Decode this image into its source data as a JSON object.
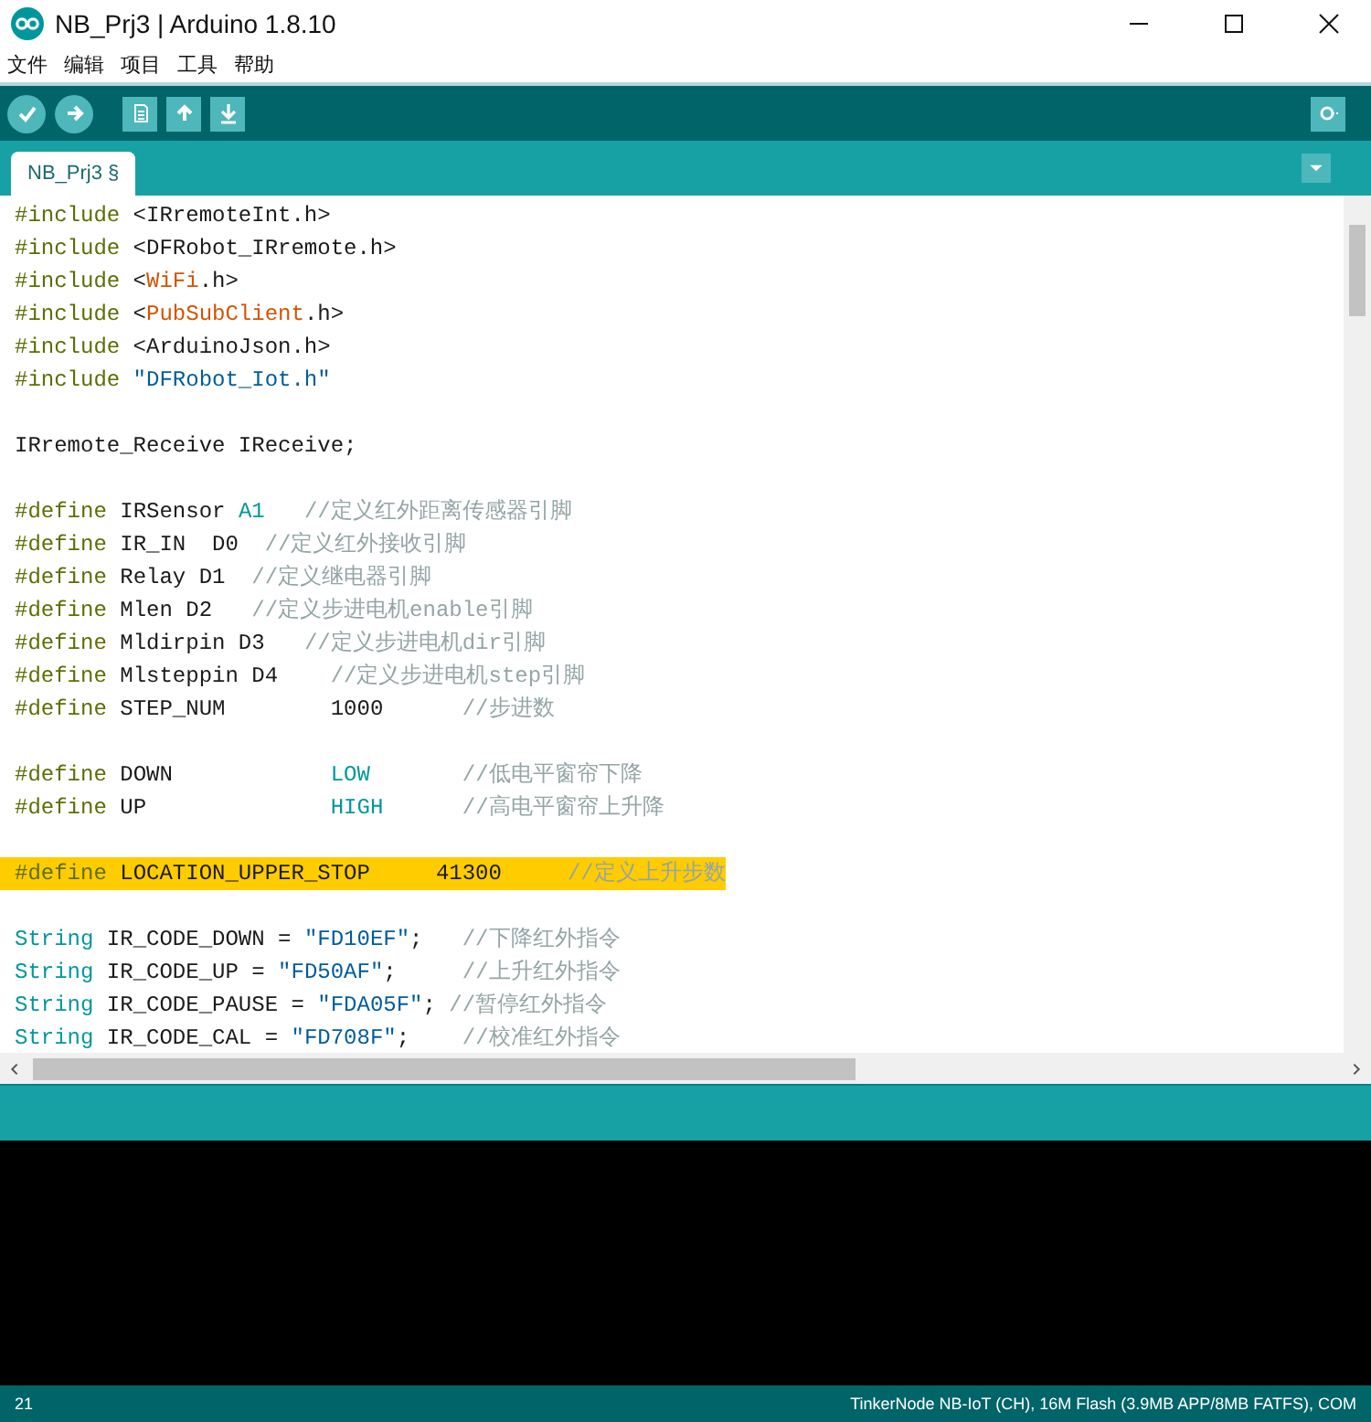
{
  "window": {
    "title": "NB_Prj3 | Arduino 1.8.10"
  },
  "menu": [
    "文件",
    "编辑",
    "项目",
    "工具",
    "帮助"
  ],
  "tabs": [
    {
      "label": "NB_Prj3 §",
      "selected": true
    }
  ],
  "code_blocks": [
    [
      {
        "highlighted": false,
        "segments": [
          {
            "kind": "dir",
            "t": "#include"
          },
          {
            "kind": "plain",
            "t": " <IRremoteInt.h>"
          }
        ]
      },
      {
        "highlighted": false,
        "segments": [
          {
            "kind": "dir",
            "t": "#include"
          },
          {
            "kind": "plain",
            "t": " <DFRobot_IRremote.h>"
          }
        ]
      },
      {
        "highlighted": false,
        "segments": [
          {
            "kind": "dir",
            "t": "#include"
          },
          {
            "kind": "plain",
            "t": " <"
          },
          {
            "kind": "lib",
            "t": "WiFi"
          },
          {
            "kind": "plain",
            "t": ".h>"
          }
        ]
      },
      {
        "highlighted": false,
        "segments": [
          {
            "kind": "dir",
            "t": "#include"
          },
          {
            "kind": "plain",
            "t": " <"
          },
          {
            "kind": "lib",
            "t": "PubSubClient"
          },
          {
            "kind": "plain",
            "t": ".h>"
          }
        ]
      },
      {
        "highlighted": false,
        "segments": [
          {
            "kind": "dir",
            "t": "#include"
          },
          {
            "kind": "plain",
            "t": " <ArduinoJson.h>"
          }
        ]
      },
      {
        "highlighted": false,
        "segments": [
          {
            "kind": "dir",
            "t": "#include"
          },
          {
            "kind": "str",
            "t": " \"DFRobot_Iot.h\""
          }
        ]
      }
    ],
    [
      {
        "highlighted": false,
        "segments": [
          {
            "kind": "plain",
            "t": "IRremote_Receive IReceive;"
          }
        ]
      }
    ],
    [
      {
        "highlighted": false,
        "segments": [
          {
            "kind": "dir",
            "t": "#define"
          },
          {
            "kind": "plain",
            "t": " IRSensor "
          },
          {
            "kind": "const",
            "t": "A1"
          },
          {
            "kind": "comment",
            "t": "   //定义红外距离传感器引脚"
          }
        ]
      },
      {
        "highlighted": false,
        "segments": [
          {
            "kind": "dir",
            "t": "#define"
          },
          {
            "kind": "plain",
            "t": " IR_IN  D0  "
          },
          {
            "kind": "comment",
            "t": "//定义红外接收引脚"
          }
        ]
      },
      {
        "highlighted": false,
        "segments": [
          {
            "kind": "dir",
            "t": "#define"
          },
          {
            "kind": "plain",
            "t": " Relay D1  "
          },
          {
            "kind": "comment",
            "t": "//定义继电器引脚"
          }
        ]
      },
      {
        "highlighted": false,
        "segments": [
          {
            "kind": "dir",
            "t": "#define"
          },
          {
            "kind": "plain",
            "t": " Mlen D2   "
          },
          {
            "kind": "comment",
            "t": "//定义步进电机enable引脚"
          }
        ]
      },
      {
        "highlighted": false,
        "segments": [
          {
            "kind": "dir",
            "t": "#define"
          },
          {
            "kind": "plain",
            "t": " Mldirpin D3   "
          },
          {
            "kind": "comment",
            "t": "//定义步进电机dir引脚"
          }
        ]
      },
      {
        "highlighted": false,
        "segments": [
          {
            "kind": "dir",
            "t": "#define"
          },
          {
            "kind": "plain",
            "t": " Mlsteppin D4    "
          },
          {
            "kind": "comment",
            "t": "//定义步进电机step引脚"
          }
        ]
      },
      {
        "highlighted": false,
        "segments": [
          {
            "kind": "dir",
            "t": "#define"
          },
          {
            "kind": "plain",
            "t": " STEP_NUM        1000      "
          },
          {
            "kind": "comment",
            "t": "//步进数"
          }
        ]
      }
    ],
    [
      {
        "highlighted": false,
        "segments": [
          {
            "kind": "dir",
            "t": "#define"
          },
          {
            "kind": "plain",
            "t": " DOWN            "
          },
          {
            "kind": "const",
            "t": "LOW"
          },
          {
            "kind": "comment",
            "t": "       //低电平窗帘下降"
          }
        ]
      },
      {
        "highlighted": false,
        "segments": [
          {
            "kind": "dir",
            "t": "#define"
          },
          {
            "kind": "plain",
            "t": " UP              "
          },
          {
            "kind": "const",
            "t": "HIGH"
          },
          {
            "kind": "comment",
            "t": "      //高电平窗帘上升降"
          }
        ]
      }
    ],
    [
      {
        "highlighted": true,
        "segments": [
          {
            "kind": "dir",
            "t": "#define"
          },
          {
            "kind": "plain",
            "t": " LOCATION_UPPER_STOP     41300     "
          },
          {
            "kind": "comment",
            "t": "//定义上升步数"
          }
        ]
      }
    ],
    [
      {
        "highlighted": false,
        "segments": [
          {
            "kind": "const",
            "t": "String"
          },
          {
            "kind": "plain",
            "t": " IR_CODE_DOWN = "
          },
          {
            "kind": "str",
            "t": "\"FD10EF\""
          },
          {
            "kind": "plain",
            "t": ";   "
          },
          {
            "kind": "comment",
            "t": "//下降红外指令"
          }
        ]
      },
      {
        "highlighted": false,
        "segments": [
          {
            "kind": "const",
            "t": "String"
          },
          {
            "kind": "plain",
            "t": " IR_CODE_UP = "
          },
          {
            "kind": "str",
            "t": "\"FD50AF\""
          },
          {
            "kind": "plain",
            "t": ";     "
          },
          {
            "kind": "comment",
            "t": "//上升红外指令"
          }
        ]
      },
      {
        "highlighted": false,
        "segments": [
          {
            "kind": "const",
            "t": "String"
          },
          {
            "kind": "plain",
            "t": " IR_CODE_PAUSE = "
          },
          {
            "kind": "str",
            "t": "\"FDA05F\""
          },
          {
            "kind": "plain",
            "t": "; "
          },
          {
            "kind": "comment",
            "t": "//暂停红外指令"
          }
        ]
      },
      {
        "highlighted": false,
        "segments": [
          {
            "kind": "const",
            "t": "String"
          },
          {
            "kind": "plain",
            "t": " IR_CODE_CAL = "
          },
          {
            "kind": "str",
            "t": "\"FD708F\""
          },
          {
            "kind": "plain",
            "t": ";    "
          },
          {
            "kind": "comment",
            "t": "//校准红外指令"
          }
        ]
      }
    ]
  ],
  "status_bar": {
    "line": "21",
    "board": "TinkerNode NB-IoT (CH), 16M Flash (3.9MB APP/8MB FATFS), COM"
  }
}
